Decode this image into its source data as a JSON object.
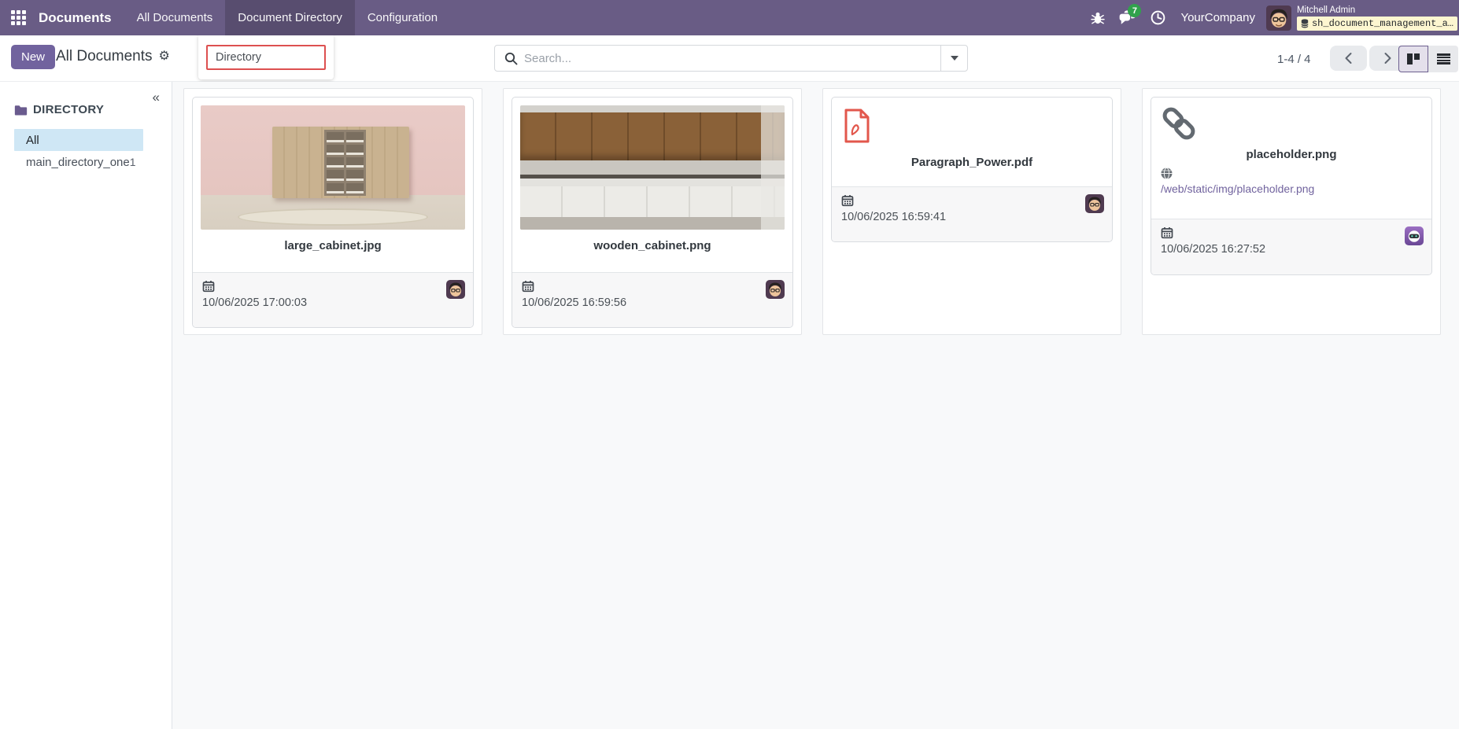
{
  "navbar": {
    "brand": "Documents",
    "menu_all_documents": "All Documents",
    "menu_document_directory": "Document Directory",
    "menu_configuration": "Configuration",
    "message_badge": "7",
    "company_name": "YourCompany",
    "user_name": "Mitchell Admin",
    "db_badge": "sh_document_management_a…"
  },
  "control_panel": {
    "new_button": "New",
    "title": "All Documents",
    "filter_value": "Directory",
    "search_placeholder": "Search...",
    "pager_text": "1-4 / 4"
  },
  "sidebar": {
    "collapse_glyph": "«",
    "section_title": "DIRECTORY",
    "item_all": "All",
    "item_main_directory": "main_directory_one",
    "item_main_directory_count": "1"
  },
  "cards": [
    {
      "type": "image",
      "name": "large_cabinet.jpg",
      "date": "10/06/2025 17:00:03"
    },
    {
      "type": "image",
      "name": "wooden_cabinet.png",
      "date": "10/06/2025 16:59:56"
    },
    {
      "type": "pdf",
      "name": "Paragraph_Power.pdf",
      "date": "10/06/2025 16:59:41"
    },
    {
      "type": "link",
      "name": "placeholder.png",
      "url": "/web/static/img/placeholder.png",
      "date": "10/06/2025 16:27:52"
    }
  ],
  "colors": {
    "navbar_bg": "#695c85",
    "primary_button": "#71639e",
    "active_menu_overlay": "#5d5177",
    "selected_row_bg": "#cfe7f5",
    "message_badge_green": "#31a24c",
    "db_badge_bg": "#fdf6d0",
    "filter_border_red": "#dd5050",
    "link_purple": "#71639e",
    "content_bg": "#f8f9fa",
    "pdf_red": "#e2574c"
  }
}
